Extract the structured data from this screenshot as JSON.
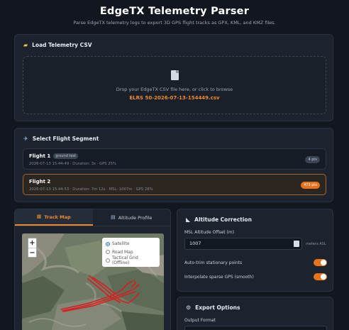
{
  "app": {
    "title": "EdgeTX Telemetry Parser",
    "subtitle": "Parse EdgeTX telemetry logs to export 3D GPS flight tracks as GPX, KML, and KMZ files."
  },
  "load": {
    "heading": "Load Telemetry CSV",
    "icon": "folder-icon",
    "drop_text": "Drop your EdgeTX CSV file here, or click to browse",
    "file_name": "ELRS 50-2026-07-13-154449.csv"
  },
  "segments": {
    "heading": "Select Flight Segment",
    "icon": "airplane-icon",
    "items": [
      {
        "name": "Flight 1",
        "tag": "ground test",
        "meta": "2026-07-13 15:44:49 · Duration: 3s · GPS 25%",
        "points": "4 pts",
        "selected": false
      },
      {
        "name": "Flight 2",
        "tag": "",
        "meta": "2026-07-13 15:44:53 · Duration: 7m 12s · MSL: 1007m · GPS 28%",
        "points": "473 pts",
        "selected": true
      }
    ]
  },
  "map_panel": {
    "tabs": [
      {
        "label": "Track Map",
        "icon": "map-icon",
        "active": true
      },
      {
        "label": "Altitude Profile",
        "icon": "chart-icon",
        "active": false
      }
    ],
    "zoom_in": "+",
    "zoom_out": "−",
    "layers": [
      {
        "label": "Satellite",
        "selected": true
      },
      {
        "label": "Road Map",
        "selected": false
      },
      {
        "label": "Tactical Grid (Offline)",
        "selected": false
      }
    ],
    "track_color": "#d42020"
  },
  "altitude": {
    "heading": "Altitude Correction",
    "icon": "ruler-icon",
    "offset_label": "MSL Altitude Offset (m)",
    "offset_value": "1007",
    "unit": "meters ASL",
    "auto_trim_label": "Auto-trim stationary points",
    "auto_trim_on": true,
    "interpolate_label": "Interpolate sparse GPS (smooth)",
    "interpolate_on": true
  },
  "export": {
    "heading": "Export Options",
    "icon": "gear-icon",
    "format_label": "Output Format"
  },
  "colors": {
    "accent": "#e8731d",
    "background": "#12171f",
    "card": "#1c232e"
  }
}
